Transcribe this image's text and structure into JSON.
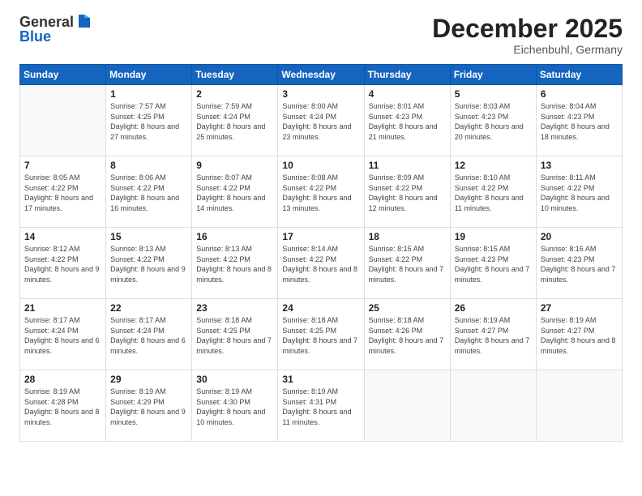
{
  "header": {
    "logo_general": "General",
    "logo_blue": "Blue",
    "month_title": "December 2025",
    "location": "Eichenbuhl, Germany"
  },
  "days_of_week": [
    "Sunday",
    "Monday",
    "Tuesday",
    "Wednesday",
    "Thursday",
    "Friday",
    "Saturday"
  ],
  "weeks": [
    [
      {
        "day": "",
        "sunrise": "",
        "sunset": "",
        "daylight": ""
      },
      {
        "day": "1",
        "sunrise": "Sunrise: 7:57 AM",
        "sunset": "Sunset: 4:25 PM",
        "daylight": "Daylight: 8 hours and 27 minutes."
      },
      {
        "day": "2",
        "sunrise": "Sunrise: 7:59 AM",
        "sunset": "Sunset: 4:24 PM",
        "daylight": "Daylight: 8 hours and 25 minutes."
      },
      {
        "day": "3",
        "sunrise": "Sunrise: 8:00 AM",
        "sunset": "Sunset: 4:24 PM",
        "daylight": "Daylight: 8 hours and 23 minutes."
      },
      {
        "day": "4",
        "sunrise": "Sunrise: 8:01 AM",
        "sunset": "Sunset: 4:23 PM",
        "daylight": "Daylight: 8 hours and 21 minutes."
      },
      {
        "day": "5",
        "sunrise": "Sunrise: 8:03 AM",
        "sunset": "Sunset: 4:23 PM",
        "daylight": "Daylight: 8 hours and 20 minutes."
      },
      {
        "day": "6",
        "sunrise": "Sunrise: 8:04 AM",
        "sunset": "Sunset: 4:23 PM",
        "daylight": "Daylight: 8 hours and 18 minutes."
      }
    ],
    [
      {
        "day": "7",
        "sunrise": "Sunrise: 8:05 AM",
        "sunset": "Sunset: 4:22 PM",
        "daylight": "Daylight: 8 hours and 17 minutes."
      },
      {
        "day": "8",
        "sunrise": "Sunrise: 8:06 AM",
        "sunset": "Sunset: 4:22 PM",
        "daylight": "Daylight: 8 hours and 16 minutes."
      },
      {
        "day": "9",
        "sunrise": "Sunrise: 8:07 AM",
        "sunset": "Sunset: 4:22 PM",
        "daylight": "Daylight: 8 hours and 14 minutes."
      },
      {
        "day": "10",
        "sunrise": "Sunrise: 8:08 AM",
        "sunset": "Sunset: 4:22 PM",
        "daylight": "Daylight: 8 hours and 13 minutes."
      },
      {
        "day": "11",
        "sunrise": "Sunrise: 8:09 AM",
        "sunset": "Sunset: 4:22 PM",
        "daylight": "Daylight: 8 hours and 12 minutes."
      },
      {
        "day": "12",
        "sunrise": "Sunrise: 8:10 AM",
        "sunset": "Sunset: 4:22 PM",
        "daylight": "Daylight: 8 hours and 11 minutes."
      },
      {
        "day": "13",
        "sunrise": "Sunrise: 8:11 AM",
        "sunset": "Sunset: 4:22 PM",
        "daylight": "Daylight: 8 hours and 10 minutes."
      }
    ],
    [
      {
        "day": "14",
        "sunrise": "Sunrise: 8:12 AM",
        "sunset": "Sunset: 4:22 PM",
        "daylight": "Daylight: 8 hours and 9 minutes."
      },
      {
        "day": "15",
        "sunrise": "Sunrise: 8:13 AM",
        "sunset": "Sunset: 4:22 PM",
        "daylight": "Daylight: 8 hours and 9 minutes."
      },
      {
        "day": "16",
        "sunrise": "Sunrise: 8:13 AM",
        "sunset": "Sunset: 4:22 PM",
        "daylight": "Daylight: 8 hours and 8 minutes."
      },
      {
        "day": "17",
        "sunrise": "Sunrise: 8:14 AM",
        "sunset": "Sunset: 4:22 PM",
        "daylight": "Daylight: 8 hours and 8 minutes."
      },
      {
        "day": "18",
        "sunrise": "Sunrise: 8:15 AM",
        "sunset": "Sunset: 4:22 PM",
        "daylight": "Daylight: 8 hours and 7 minutes."
      },
      {
        "day": "19",
        "sunrise": "Sunrise: 8:15 AM",
        "sunset": "Sunset: 4:23 PM",
        "daylight": "Daylight: 8 hours and 7 minutes."
      },
      {
        "day": "20",
        "sunrise": "Sunrise: 8:16 AM",
        "sunset": "Sunset: 4:23 PM",
        "daylight": "Daylight: 8 hours and 7 minutes."
      }
    ],
    [
      {
        "day": "21",
        "sunrise": "Sunrise: 8:17 AM",
        "sunset": "Sunset: 4:24 PM",
        "daylight": "Daylight: 8 hours and 6 minutes."
      },
      {
        "day": "22",
        "sunrise": "Sunrise: 8:17 AM",
        "sunset": "Sunset: 4:24 PM",
        "daylight": "Daylight: 8 hours and 6 minutes."
      },
      {
        "day": "23",
        "sunrise": "Sunrise: 8:18 AM",
        "sunset": "Sunset: 4:25 PM",
        "daylight": "Daylight: 8 hours and 7 minutes."
      },
      {
        "day": "24",
        "sunrise": "Sunrise: 8:18 AM",
        "sunset": "Sunset: 4:25 PM",
        "daylight": "Daylight: 8 hours and 7 minutes."
      },
      {
        "day": "25",
        "sunrise": "Sunrise: 8:18 AM",
        "sunset": "Sunset: 4:26 PM",
        "daylight": "Daylight: 8 hours and 7 minutes."
      },
      {
        "day": "26",
        "sunrise": "Sunrise: 8:19 AM",
        "sunset": "Sunset: 4:27 PM",
        "daylight": "Daylight: 8 hours and 7 minutes."
      },
      {
        "day": "27",
        "sunrise": "Sunrise: 8:19 AM",
        "sunset": "Sunset: 4:27 PM",
        "daylight": "Daylight: 8 hours and 8 minutes."
      }
    ],
    [
      {
        "day": "28",
        "sunrise": "Sunrise: 8:19 AM",
        "sunset": "Sunset: 4:28 PM",
        "daylight": "Daylight: 8 hours and 8 minutes."
      },
      {
        "day": "29",
        "sunrise": "Sunrise: 8:19 AM",
        "sunset": "Sunset: 4:29 PM",
        "daylight": "Daylight: 8 hours and 9 minutes."
      },
      {
        "day": "30",
        "sunrise": "Sunrise: 8:19 AM",
        "sunset": "Sunset: 4:30 PM",
        "daylight": "Daylight: 8 hours and 10 minutes."
      },
      {
        "day": "31",
        "sunrise": "Sunrise: 8:19 AM",
        "sunset": "Sunset: 4:31 PM",
        "daylight": "Daylight: 8 hours and 11 minutes."
      },
      {
        "day": "",
        "sunrise": "",
        "sunset": "",
        "daylight": ""
      },
      {
        "day": "",
        "sunrise": "",
        "sunset": "",
        "daylight": ""
      },
      {
        "day": "",
        "sunrise": "",
        "sunset": "",
        "daylight": ""
      }
    ]
  ]
}
